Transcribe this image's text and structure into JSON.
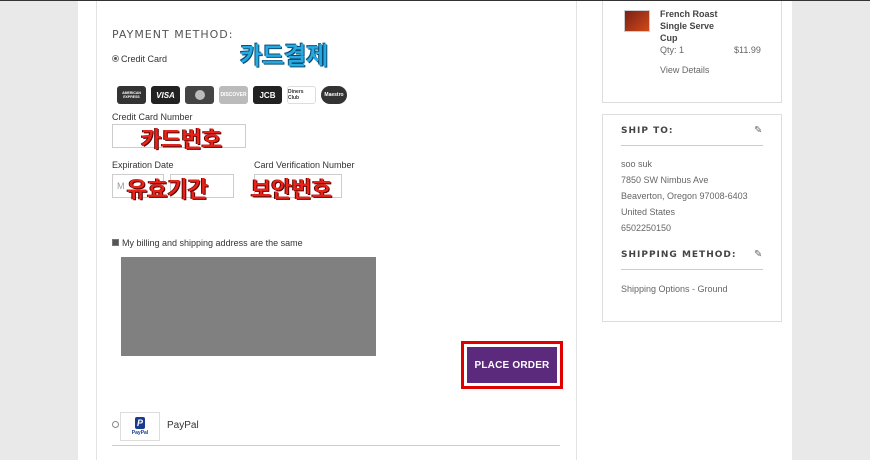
{
  "payment": {
    "heading": "PAYMENT METHOD:",
    "credit_card_label": "Credit Card",
    "annotation_card": "카드결제",
    "card_logos": [
      "AMERICAN EXPRESS",
      "VISA",
      "MC",
      "DISCOVER",
      "JCB",
      "Diners Club",
      "Maestro"
    ],
    "card_number_label": "Credit Card Number",
    "annotation_number": "카드번호",
    "expiration_label": "Expiration Date",
    "expiration_month_placeholder": "M",
    "annotation_expiration": "유효기간",
    "cvv_label": "Card Verification Number",
    "annotation_cvv": "보안번호",
    "billing_same_label": "My billing and shipping address are the same",
    "place_order_label": "PLACE ORDER",
    "paypal_label": "PayPal",
    "paypal_logo_text": "PayPal"
  },
  "summary": {
    "product_name": "French Roast Single Serve Cup",
    "qty": "Qty: 1",
    "price": "$11.99",
    "view_details": "View Details"
  },
  "ship_to": {
    "title": "SHIP TO:",
    "lines": [
      "soo suk",
      "7850 SW Nimbus Ave",
      "Beaverton, Oregon 97008-6403",
      "United States",
      "6502250150"
    ]
  },
  "shipping_method": {
    "title": "SHIPPING METHOD:",
    "value": "Shipping Options - Ground"
  },
  "colors": {
    "place_order_bg": "#5b2a7d",
    "highlight_border": "#e00000",
    "annotation_blue": "#27a9e1",
    "annotation_red": "#e8231a"
  }
}
